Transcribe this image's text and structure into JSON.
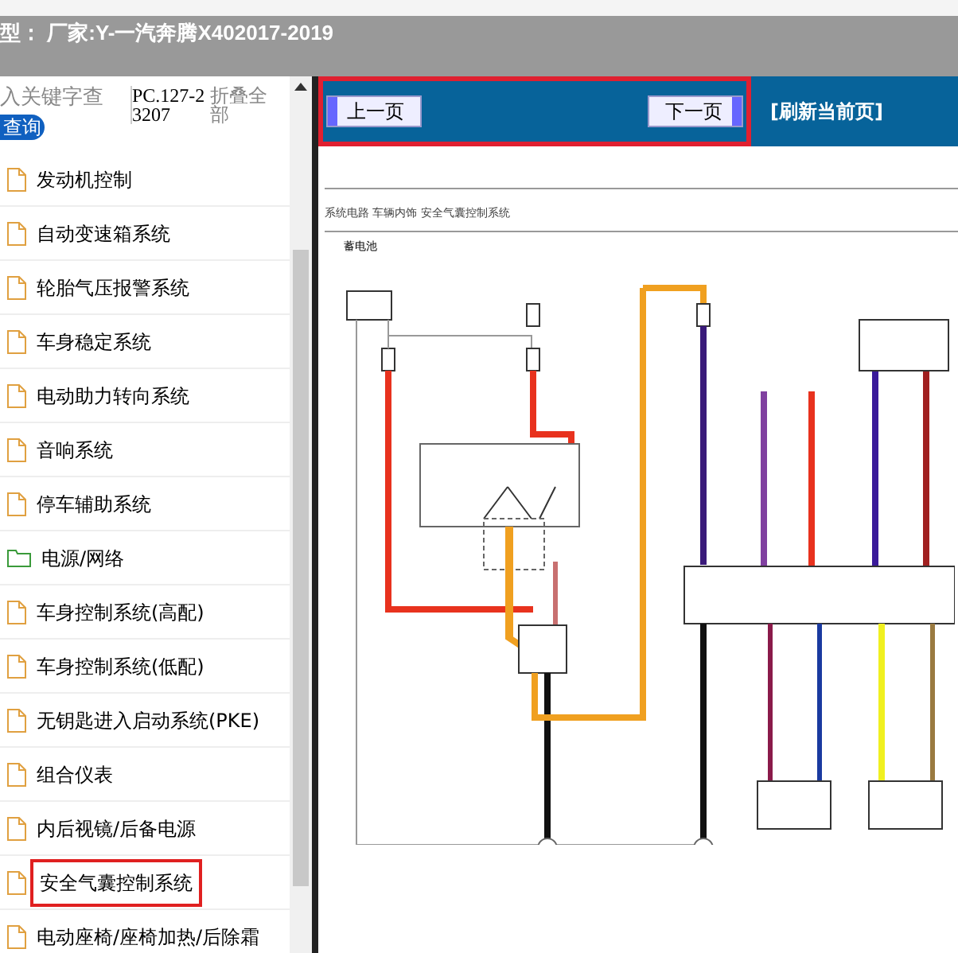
{
  "header": {
    "title": "型： 厂家:Y-一汽奔腾X402017-2019"
  },
  "search": {
    "placeholder": "入关键字查",
    "button": "查询",
    "code": "PC.127-23207",
    "collapse": "折叠全部"
  },
  "tree": [
    {
      "label": "发动机控制",
      "kind": "doc",
      "selected": false
    },
    {
      "label": "自动变速箱系统",
      "kind": "doc",
      "selected": false
    },
    {
      "label": "轮胎气压报警系统",
      "kind": "doc",
      "selected": false
    },
    {
      "label": "车身稳定系统",
      "kind": "doc",
      "selected": false
    },
    {
      "label": "电动助力转向系统",
      "kind": "doc",
      "selected": false
    },
    {
      "label": "音响系统",
      "kind": "doc",
      "selected": false
    },
    {
      "label": "停车辅助系统",
      "kind": "doc",
      "selected": false
    },
    {
      "label": "电源/网络",
      "kind": "folder",
      "selected": false
    },
    {
      "label": "车身控制系统(高配)",
      "kind": "doc",
      "selected": false
    },
    {
      "label": "车身控制系统(低配)",
      "kind": "doc",
      "selected": false
    },
    {
      "label": "无钥匙进入启动系统(PKE)",
      "kind": "doc",
      "selected": false
    },
    {
      "label": "组合仪表",
      "kind": "doc",
      "selected": false
    },
    {
      "label": "内后视镜/后备电源",
      "kind": "doc",
      "selected": false
    },
    {
      "label": "安全气囊控制系统",
      "kind": "doc",
      "selected": true
    },
    {
      "label": "电动座椅/座椅加热/后除霜",
      "kind": "doc",
      "selected": false
    }
  ],
  "nav": {
    "prev": "上一页",
    "next": "下一页",
    "refresh": "[刷新当前页]"
  },
  "document": {
    "heading": "系统电路 车辆内饰 安全气囊控制系统",
    "battery": "蓄电池"
  }
}
